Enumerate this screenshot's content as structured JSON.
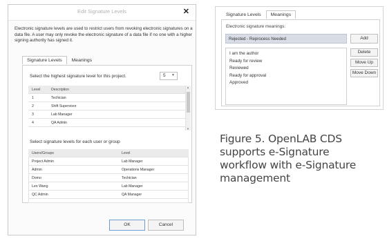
{
  "dialog": {
    "title": "Edit Signature Levels",
    "close_glyph": "✕",
    "description": "Electronic signature levels are used to restrict users from revoking electronic signatures on a data file. A user may only revoke the electronic signature of a data file if no one with a higher signing authority has signed it.",
    "tabs": [
      {
        "label": "Signature Levels",
        "active": true
      },
      {
        "label": "Meanings",
        "active": false
      }
    ],
    "highest_level_label": "Select the highest signature level for this project.",
    "highest_level_value": "5",
    "levels_table": {
      "headers": [
        "Level",
        "Description"
      ],
      "rows": [
        [
          "1",
          "Techician"
        ],
        [
          "2",
          "Shift Supervisor"
        ],
        [
          "3",
          "Lab Manager"
        ],
        [
          "4",
          "QA Admin"
        ]
      ]
    },
    "assign_label": "Select signature levels for each user or group",
    "users_table": {
      "headers": [
        "Users/Groups",
        "Level"
      ],
      "rows": [
        [
          "Project Admin",
          "Lab Manager"
        ],
        [
          "Admin",
          "Operations Manager"
        ],
        [
          "Domo",
          "Techician"
        ],
        [
          "Leo Wang",
          "Lab Manager"
        ],
        [
          "QC Admin",
          "QA Manager"
        ]
      ]
    },
    "ok_label": "OK",
    "cancel_label": "Cancel"
  },
  "meanings_panel": {
    "tabs": [
      {
        "label": "Signature Levels",
        "active": false
      },
      {
        "label": "Meanings",
        "active": true
      }
    ],
    "label": "Electronic signature meanings:",
    "input_value": "Rejected - Reprocess Needed",
    "add_label": "Add",
    "items": [
      "I am the author",
      "Ready for review",
      "Reviewed",
      "Ready for approval",
      "Approved"
    ],
    "delete_label": "Delete",
    "move_up_label": "Move Up",
    "move_down_label": "Move Down"
  },
  "caption": {
    "lines": [
      "Figure 5. OpenLAB CDS",
      "supports e-Signature",
      "workflow with e-Signature",
      "management"
    ]
  },
  "colors": {
    "dialog_bg": "#fbfbfb",
    "input_highlight": "#d9dde6",
    "header_row": "#ebebeb",
    "ok_border": "#6f9bd1"
  }
}
